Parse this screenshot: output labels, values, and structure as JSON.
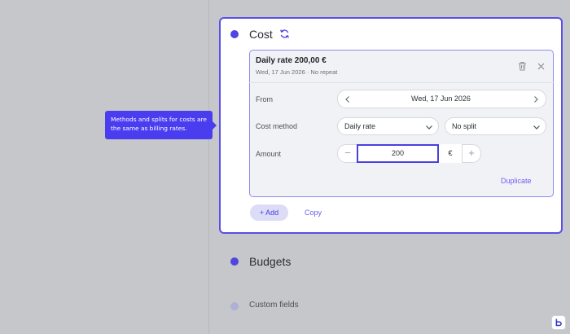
{
  "tooltip": {
    "text": "Methods and splits for costs are the same as billing rates."
  },
  "cost": {
    "title": "Cost",
    "rate_title": "Daily rate 200,00 €",
    "rate_subtitle": "Wed, 17 Jun 2026 · No repeat",
    "from_label": "From",
    "from_value": "Wed, 17 Jun 2026",
    "method_label": "Cost method",
    "method_value": "Daily rate",
    "split_value": "No split",
    "amount_label": "Amount",
    "amount_value": "200",
    "currency": "€",
    "minus": "−",
    "plus": "+",
    "duplicate": "Duplicate",
    "add": "+ Add",
    "copy": "Copy"
  },
  "sections": {
    "budgets": "Budgets",
    "custom_fields": "Custom fields"
  },
  "colors": {
    "accent": "#4a40de",
    "tooltip_bg": "#4a3df0",
    "page_bg": "#c6c7ca"
  },
  "icons": [
    "refresh-icon",
    "trash-icon",
    "close-icon",
    "chevron-left-icon",
    "chevron-right-icon",
    "chevron-down-icon",
    "app-logo-icon"
  ]
}
